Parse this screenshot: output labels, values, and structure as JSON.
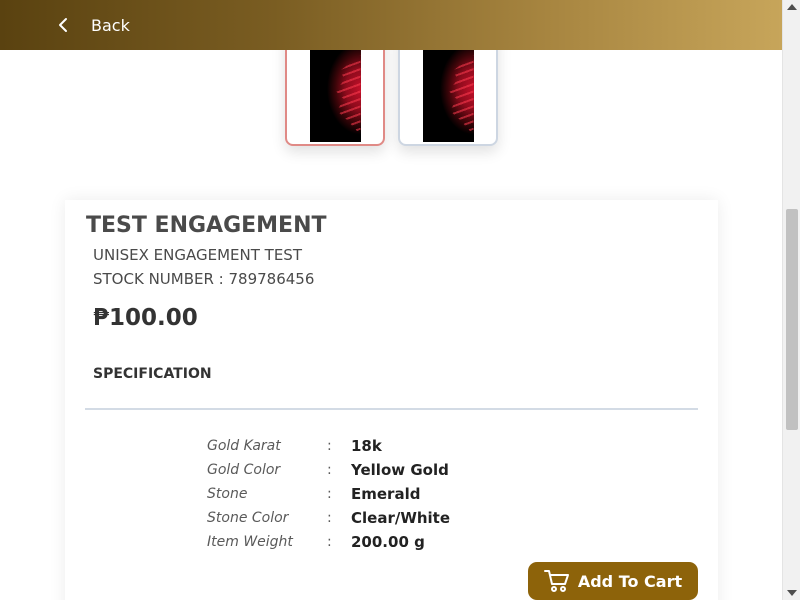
{
  "header": {
    "back_label": "Back",
    "gradient_start": "#5a4210",
    "gradient_end": "#c7a55a"
  },
  "gallery": {
    "thumbnails": [
      {
        "alt": "red abstract jewel image",
        "selected": true
      },
      {
        "alt": "red abstract jewel image",
        "selected": false
      }
    ]
  },
  "product": {
    "title": "TEST ENGAGEMENT",
    "subtitle": "UNISEX ENGAGEMENT TEST",
    "stock_number": "STOCK NUMBER : 789786456",
    "price": "₱100.00"
  },
  "specification": {
    "heading": "SPECIFICATION",
    "separator": ":",
    "rows": [
      {
        "label": "Gold Karat",
        "value": "18k"
      },
      {
        "label": "Gold Color",
        "value": "Yellow Gold"
      },
      {
        "label": "Stone",
        "value": "Emerald"
      },
      {
        "label": "Stone Color",
        "value": "Clear/White"
      },
      {
        "label": "Item Weight",
        "value": "200.00 g"
      }
    ]
  },
  "actions": {
    "add_to_cart_label": "Add To Cart",
    "button_color": "#8d630a",
    "icon": "cart-icon"
  }
}
